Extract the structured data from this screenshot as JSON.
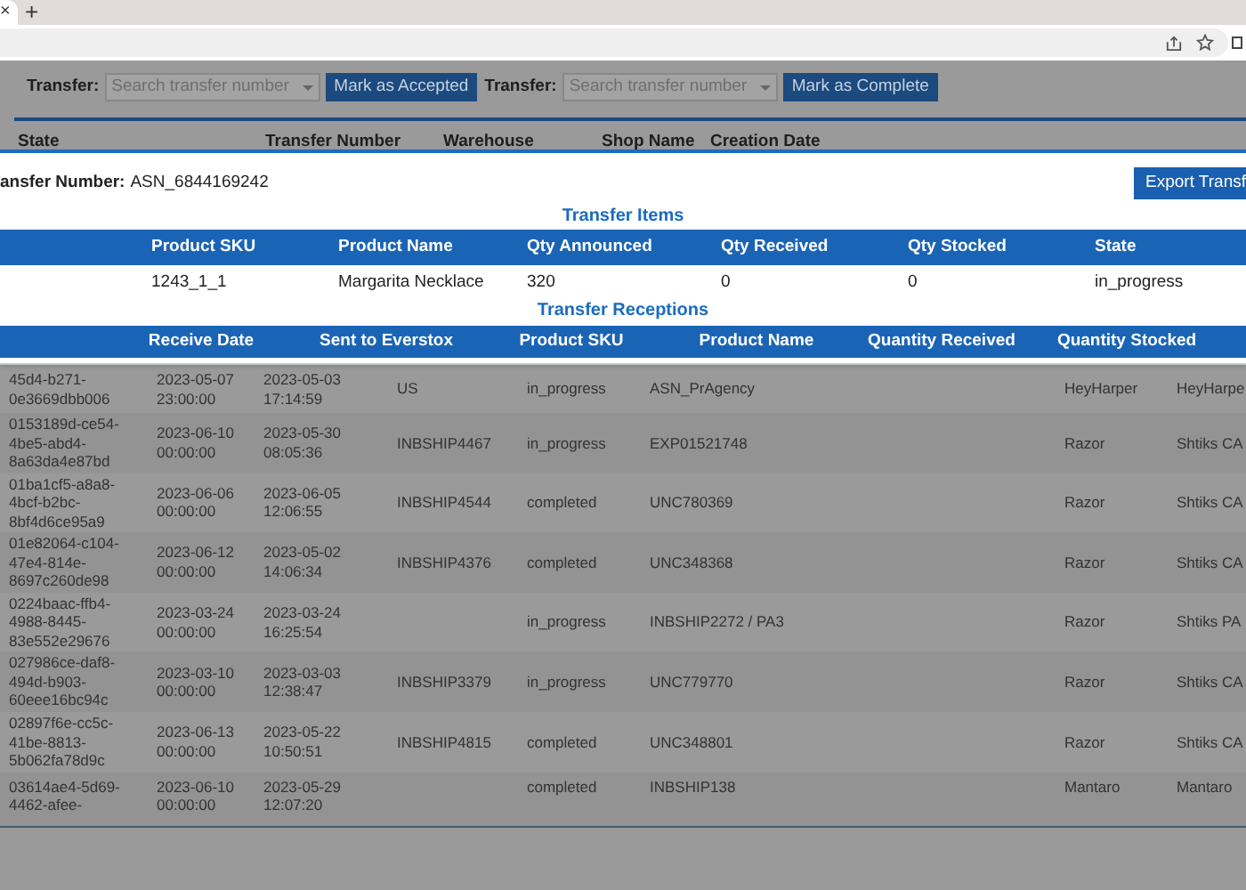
{
  "browser": {
    "new_tab": "+",
    "close_tab": "×"
  },
  "toolbar": [
    {
      "label": "Transfer:",
      "placeholder": "Search transfer number",
      "button": "Mark as Accepted"
    },
    {
      "label": "Transfer:",
      "placeholder": "Search transfer number",
      "button": "Mark as Complete"
    }
  ],
  "list_header": [
    "State",
    "Transfer Number",
    "Warehouse",
    "Shop Name",
    "Creation Date"
  ],
  "list_rows": [
    [
      "45d4-b271-0e3669dbb006",
      "2023-05-07 23:00:00",
      "2023-05-03 17:14:59",
      "US",
      "in_progress",
      "ASN_PrAgency",
      "HeyHarper",
      "HeyHarpe"
    ],
    [
      "0153189d-ce54-4be5-abd4-8a63da4e87bd",
      "2023-06-10 00:00:00",
      "2023-05-30 08:05:36",
      "INBSHIP4467",
      "in_progress",
      "EXP01521748",
      "Razor",
      "Shtiks CA"
    ],
    [
      "01ba1cf5-a8a8-4bcf-b2bc-8bf4d6ce95a9",
      "2023-06-06 00:00:00",
      "2023-06-05 12:06:55",
      "INBSHIP4544",
      "completed",
      "UNC780369",
      "Razor",
      "Shtiks CA"
    ],
    [
      "01e82064-c104-47e4-814e-8697c260de98",
      "2023-06-12 00:00:00",
      "2023-05-02 14:06:34",
      "INBSHIP4376",
      "completed",
      "UNC348368",
      "Razor",
      "Shtiks CA"
    ],
    [
      "0224baac-ffb4-4988-8445-83e552e29676",
      "2023-03-24 00:00:00",
      "2023-03-24 16:25:54",
      "",
      "in_progress",
      "INBSHIP2272 / PA3",
      "Razor",
      "Shtiks PA"
    ],
    [
      "027986ce-daf8-494d-b903-60eee16bc94c",
      "2023-03-10 00:00:00",
      "2023-03-03 12:38:47",
      "INBSHIP3379",
      "in_progress",
      "UNC779770",
      "Razor",
      "Shtiks CA"
    ],
    [
      "02897f6e-cc5c-41be-8813-5b062fa78d9c",
      "2023-06-13 00:00:00",
      "2023-05-22 10:50:51",
      "INBSHIP4815",
      "completed",
      "UNC348801",
      "Razor",
      "Shtiks CA"
    ],
    [
      "03614ae4-5d69-4462-afee-",
      "2023-06-10 00:00:00",
      "2023-05-29 12:07:20",
      "",
      "completed",
      "INBSHIP138",
      "Mantaro",
      "Mantaro"
    ]
  ],
  "modal": {
    "transfer_label": "ansfer Number:",
    "transfer_number": "ASN_6844169242",
    "export_button": "Export Transf",
    "items_title": "Transfer Items",
    "items_columns": [
      "Product SKU",
      "Product Name",
      "Qty Announced",
      "Qty Received",
      "Qty Stocked",
      "State"
    ],
    "items_rows": [
      [
        "1243_1_1",
        "Margarita Necklace",
        "320",
        "0",
        "0",
        "in_progress"
      ]
    ],
    "receptions_title": "Transfer Receptions",
    "receptions_columns": [
      "Receive Date",
      "Sent to Everstox",
      "Product SKU",
      "Product Name",
      "Quantity Received",
      "Quantity Stocked"
    ]
  }
}
